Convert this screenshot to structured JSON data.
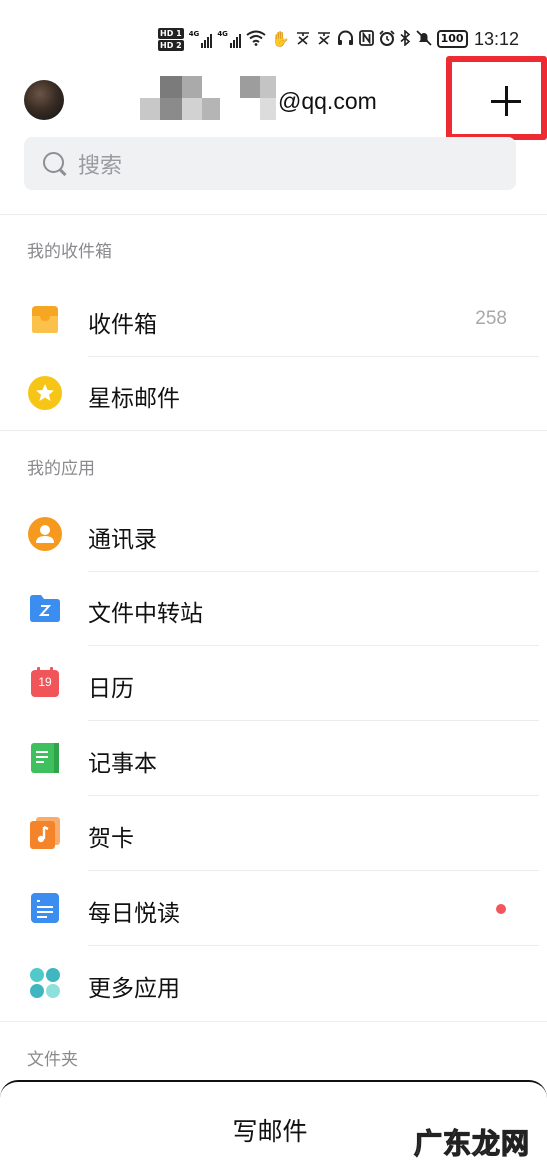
{
  "status_bar": {
    "hd1": "HD 1",
    "hd2": "HD 2",
    "net1": "4G",
    "net2": "4G",
    "battery": "100",
    "time": "13:12"
  },
  "header": {
    "account_visible": "@qq.com",
    "add_button": "+"
  },
  "search": {
    "placeholder": "搜索"
  },
  "sections": {
    "mailbox": "我的收件箱",
    "apps": "我的应用",
    "folders": "文件夹"
  },
  "mailbox_items": [
    {
      "label": "收件箱",
      "count": "258",
      "icon": "inbox-icon",
      "color": "#f5a623"
    },
    {
      "label": "星标邮件",
      "icon": "star-icon",
      "color": "#f7c515"
    }
  ],
  "app_items": [
    {
      "label": "通讯录",
      "icon": "contacts-icon",
      "color": "#f59a1f"
    },
    {
      "label": "文件中转站",
      "icon": "file-transfer-icon",
      "color": "#3b8df0"
    },
    {
      "label": "日历",
      "icon": "calendar-icon",
      "color": "#f0555a",
      "calendar_day": "19"
    },
    {
      "label": "记事本",
      "icon": "notebook-icon",
      "color": "#3fc05e"
    },
    {
      "label": "贺卡",
      "icon": "greeting-card-icon",
      "color": "#f5832a"
    },
    {
      "label": "每日悦读",
      "icon": "daily-reading-icon",
      "color": "#3b8df0",
      "unread_dot": true
    },
    {
      "label": "更多应用",
      "icon": "more-apps-icon",
      "color": "#4fc9c9"
    }
  ],
  "compose": {
    "label": "写邮件"
  },
  "watermark": "广东龙网",
  "colors": {
    "highlight": "#ee2b33",
    "badge_dot": "#f2555c",
    "search_bg": "#f0f1f3"
  }
}
